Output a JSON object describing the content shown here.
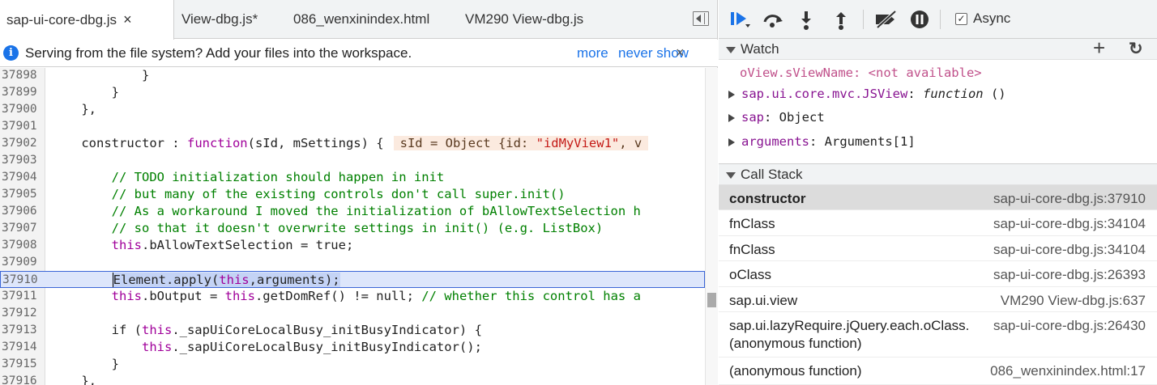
{
  "editor": {
    "tabs": [
      {
        "label": "sap-ui-core-dbg.js",
        "close": "×"
      },
      {
        "label": "View-dbg.js*"
      },
      {
        "label": "086_wenxinindex.html"
      },
      {
        "label": "VM290 View-dbg.js"
      }
    ],
    "info_icon": "i",
    "info_text": "Serving from the file system? Add your files into the workspace.",
    "info_more": "more",
    "info_never_show": "never show",
    "info_close": "×",
    "lines": [
      {
        "n": "37898",
        "text": "            }"
      },
      {
        "n": "37899",
        "text": "        }"
      },
      {
        "n": "37900",
        "text": "    },"
      },
      {
        "n": "37901",
        "text": ""
      },
      {
        "n": "37902",
        "pre": "    constructor : ",
        "kw": "function",
        "post": "(sId, mSettings) {",
        "inline_pre": "sId = Object {id: ",
        "inline_str": "\"idMyView1\"",
        "inline_post": ", v"
      },
      {
        "n": "37903",
        "text": ""
      },
      {
        "n": "37904",
        "comment": "        // TODO initialization should happen in init"
      },
      {
        "n": "37905",
        "comment": "        // but many of the existing controls don't call super.init()"
      },
      {
        "n": "37906",
        "comment": "        // As a workaround I moved the initialization of bAllowTextSelection h"
      },
      {
        "n": "37907",
        "comment": "        // so that it doesn't overwrite settings in init() (e.g. ListBox)"
      },
      {
        "n": "37908",
        "pre": "        ",
        "kw": "this",
        "post": ".bAllowTextSelection = true;"
      },
      {
        "n": "37909",
        "text": ""
      },
      {
        "n": "37910",
        "pre": "        ",
        "sel_a": "Element.apply(",
        "kw": "this",
        "sel_b": ",arguments);",
        "highlight": true
      },
      {
        "n": "37911",
        "pre": "        ",
        "kw": "this",
        "mid": ".bOutput = ",
        "kw2": "this",
        "post": ".getDomRef() != null; ",
        "comment": "// whether this control has a"
      },
      {
        "n": "37912",
        "text": ""
      },
      {
        "n": "37913",
        "pre": "        if (",
        "kw": "this",
        "post": "._sapUiCoreLocalBusy_initBusyIndicator) {"
      },
      {
        "n": "37914",
        "pre": "            ",
        "kw": "this",
        "post": "._sapUiCoreLocalBusy_initBusyIndicator();"
      },
      {
        "n": "37915",
        "text": "        }"
      },
      {
        "n": "37916",
        "text": "    },"
      }
    ]
  },
  "debugger": {
    "async_label": "Async",
    "async_checked": "✓",
    "watch": {
      "title": "Watch",
      "add": "+",
      "refresh": "↻",
      "items": [
        {
          "name": "oView.sViewName",
          "sep": ": ",
          "value": "<not available>",
          "unavailable": true
        },
        {
          "name": "sap.ui.core.mvc.JSView",
          "sep": ": ",
          "value_kw": "function",
          "value": " ()",
          "expandable": true
        },
        {
          "name": "sap",
          "sep": ": ",
          "value": "Object",
          "expandable": true
        },
        {
          "name": "arguments",
          "sep": ": ",
          "value": "Arguments[1]",
          "expandable": true
        }
      ]
    },
    "callstack": {
      "title": "Call Stack",
      "frames": [
        {
          "fn": "constructor",
          "loc": "sap-ui-core-dbg.js:37910",
          "selected": true
        },
        {
          "fn": "fnClass",
          "loc": "sap-ui-core-dbg.js:34104"
        },
        {
          "fn": "fnClass",
          "loc": "sap-ui-core-dbg.js:34104"
        },
        {
          "fn": "oClass",
          "loc": "sap-ui-core-dbg.js:26393"
        },
        {
          "fn": "sap.ui.view",
          "loc": "VM290 View-dbg.js:637"
        },
        {
          "fn": "sap.ui.lazyRequire.jQuery.each.oClass.",
          "fn2": "(anonymous function)",
          "loc": "sap-ui-core-dbg.js:26430"
        },
        {
          "fn": "(anonymous function)",
          "loc": "086_wenxinindex.html:17"
        }
      ]
    }
  }
}
